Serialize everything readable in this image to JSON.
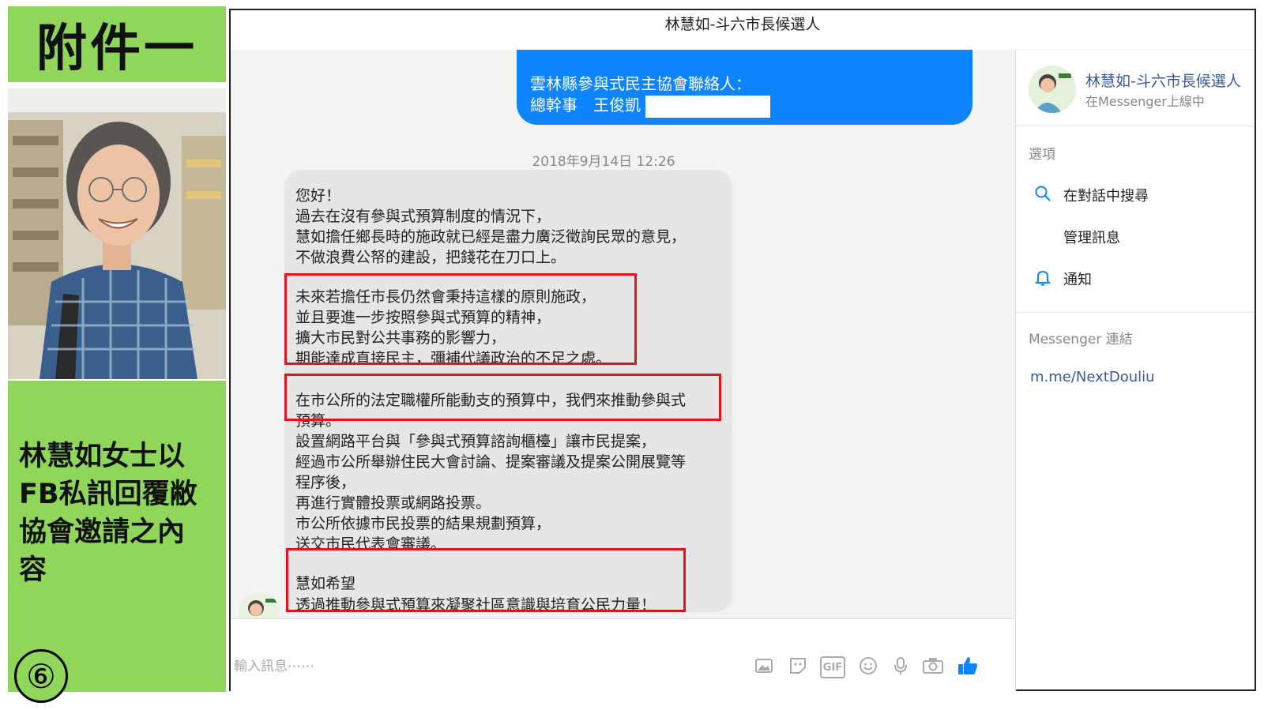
{
  "attachment": {
    "title": "附件一",
    "caption": "林慧如女士以\nFB私訊回覆敝\n協會邀請之內\n容",
    "page_number": "⑥"
  },
  "conversation": {
    "title": "林慧如-斗六市長候選人",
    "sent_message": {
      "line1": "雲林縣參與式民主協會聯絡人：",
      "line2": "總幹事　王俊凱"
    },
    "timestamp": "2018年9月14日 12:26",
    "received_lines": [
      "您好！",
      "過去在沒有參與式預算制度的情況下，",
      "慧如擔任鄉長時的施政就已經是盡力廣泛徵詢民眾的意見，",
      "不做浪費公帑的建設，把錢花在刀口上。",
      "未來若擔任市長仍然會秉持這樣的原則施政，",
      "並且要進一步按照參與式預算的精神，",
      "擴大市民對公共事務的影響力，",
      "期能達成直接民主，彌補代議政治的不足之處。",
      "在市公所的法定職權所能動支的預算中，我們來推動參與式",
      "預算。",
      "設置網路平台與「參與式預算諮詢櫃檯」讓市民提案，",
      "經過市公所舉辦住民大會討論、提案審議及提案公開展覽等",
      "程序後，",
      "再進行實體投票或網路投票。",
      "市公所依據市民投票的結果規劃預算，",
      "送交市民代表會審議。",
      "慧如希望",
      "透過推動參與式預算來凝聚社區意識與培育公民力量！"
    ],
    "input_placeholder": "輸入訊息⋯⋯",
    "toolbar_icons": [
      "image-icon",
      "sticker-icon",
      "gif-icon",
      "emoji-icon",
      "microphone-icon",
      "camera-icon",
      "thumbs-up-icon"
    ],
    "gif_label": "GIF"
  },
  "sidebar": {
    "name": "林慧如-斗六市長候選人",
    "status": "在Messenger上線中",
    "options_heading": "選項",
    "options": [
      "在對話中搜尋",
      "管理訊息",
      "通知"
    ],
    "links_heading": "Messenger 連結",
    "link": "m.me/NextDouliu"
  },
  "colors": {
    "accent_green": "#8fd65a",
    "messenger_blue": "#0f84ff",
    "highlight_red": "#e8101a"
  }
}
